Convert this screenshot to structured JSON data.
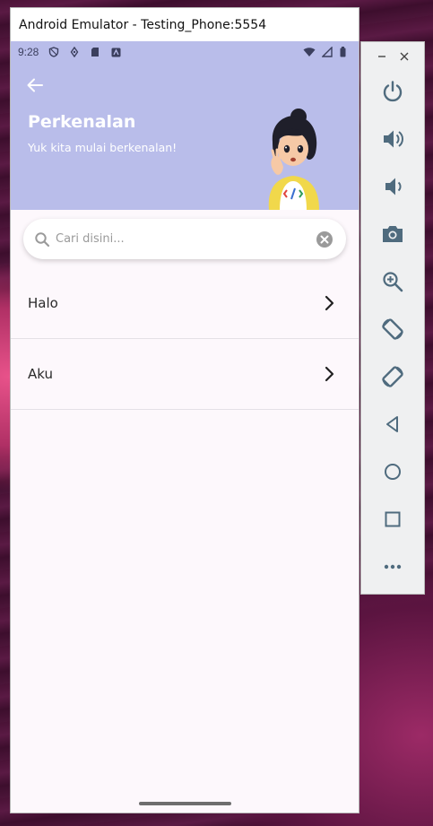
{
  "window": {
    "title": "Android Emulator - Testing_Phone:5554"
  },
  "status_bar": {
    "time": "9:28",
    "left_icons": [
      "shield-icon",
      "location-icon",
      "sd-card-icon",
      "notification-icon"
    ],
    "right_icons": [
      "wifi-icon",
      "signal-icon",
      "battery-icon"
    ]
  },
  "header": {
    "title": "Perkenalan",
    "subtitle": "Yuk kita mulai berkenalan!",
    "background_color": "#b9bdea"
  },
  "search": {
    "placeholder": "Cari disini...",
    "value": ""
  },
  "list": {
    "items": [
      {
        "label": "Halo"
      },
      {
        "label": "Aku"
      }
    ]
  },
  "side_panel": {
    "buttons": [
      "power-icon",
      "volume-up-icon",
      "volume-down-icon",
      "camera-icon",
      "zoom-icon",
      "rotate-left-icon",
      "rotate-right-icon",
      "back-icon",
      "home-icon",
      "overview-icon",
      "more-icon"
    ]
  }
}
